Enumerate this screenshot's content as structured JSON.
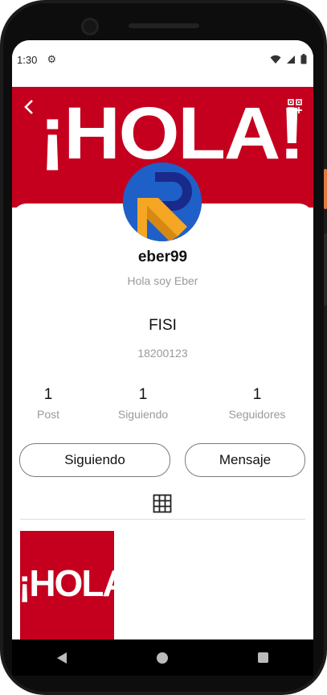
{
  "status_bar": {
    "time": "1:30"
  },
  "banner": {
    "brand": "¡HOLA!"
  },
  "profile": {
    "username": "eber99",
    "bio": "Hola soy Eber",
    "school": "FISI",
    "code": "18200123"
  },
  "stats": [
    {
      "value": "1",
      "label": "Post"
    },
    {
      "value": "1",
      "label": "Siguiendo"
    },
    {
      "value": "1",
      "label": "Seguidores"
    }
  ],
  "buttons": {
    "following": "Siguiendo",
    "message": "Mensaje"
  },
  "posts": [
    {
      "brand": "¡HOLA!"
    }
  ],
  "colors": {
    "brand_red": "#c4001e",
    "avatar_blue": "#1f5fc8",
    "avatar_orange": "#f5a623"
  }
}
